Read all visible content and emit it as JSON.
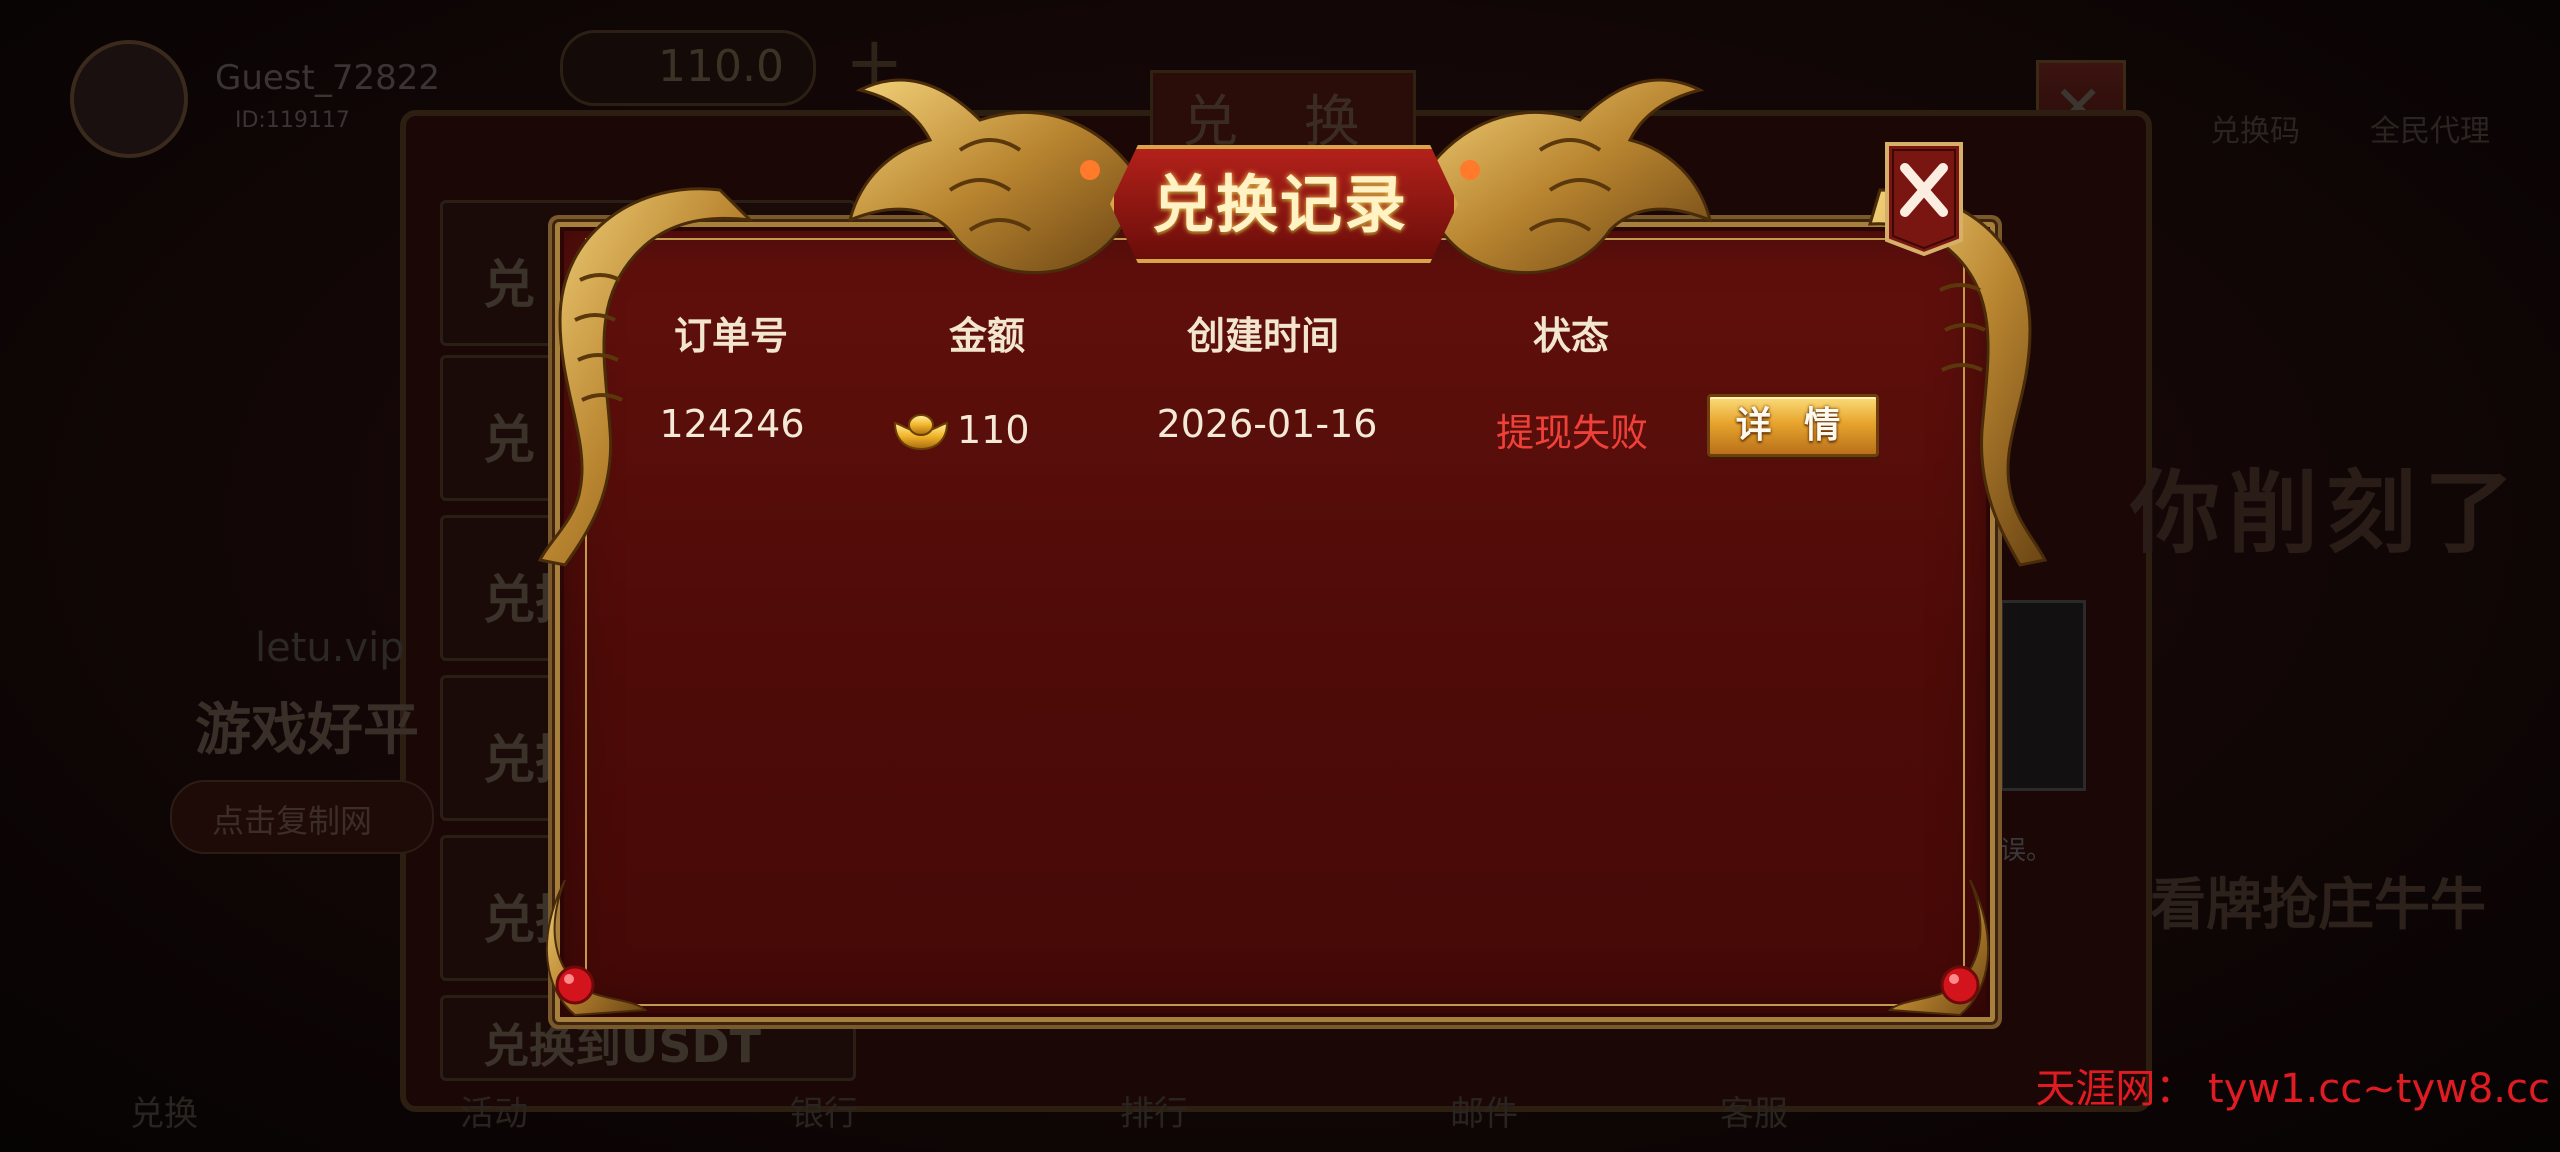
{
  "background": {
    "username": "Guest_72822",
    "user_id": "ID:119117",
    "balance": "110.0",
    "panel_title": "兑 换",
    "tabs": [
      "兑",
      "兑",
      "兑换",
      "兑换",
      "兑换",
      "兑换到USDT"
    ],
    "top_icons": [
      "兑换码",
      "全民代理"
    ],
    "left_site": "letu.vip",
    "left_slogan": "游戏好平",
    "left_button": "点击复制网",
    "right_banner": "你削刻了",
    "right_banner2": "看牌抢庄牛牛",
    "right_hint": "误。",
    "bottom_nav": [
      "兑换",
      "活动",
      "银行",
      "排行",
      "邮件",
      "客服"
    ]
  },
  "dialog": {
    "title": "兑换记录",
    "columns": [
      "订单号",
      "金额",
      "创建时间",
      "状态"
    ],
    "rows": [
      {
        "order_id": "124246",
        "amount": "110",
        "created": "2026-01-16",
        "status": "提现失败",
        "action": "详 情"
      }
    ]
  },
  "watermark": "天涯网：  tyw1.cc~tyw8.cc",
  "colors": {
    "status_failed": "#f0403a",
    "frame_gold": "#c29a4b",
    "dialog_bg": "#550d09",
    "watermark": "#e11b22"
  }
}
